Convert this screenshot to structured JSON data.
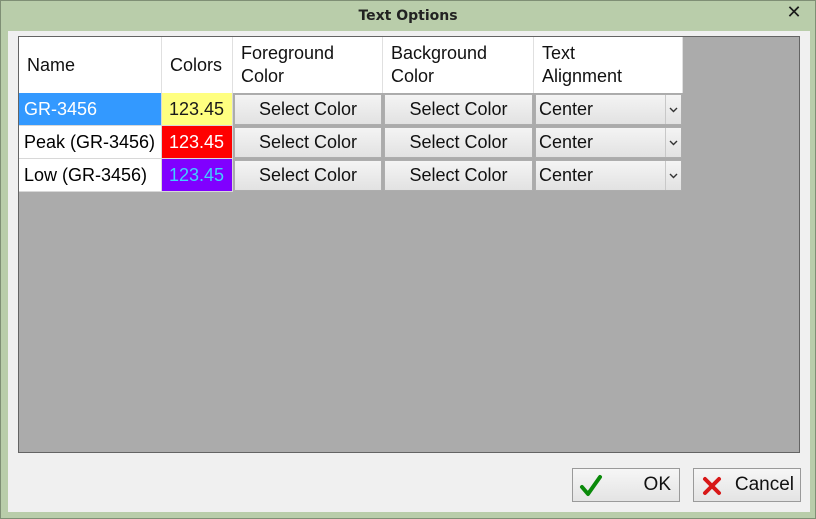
{
  "window": {
    "title": "Text Options",
    "close_glyph": "✕"
  },
  "grid": {
    "columns": [
      {
        "label": "Name"
      },
      {
        "label": "Colors"
      },
      {
        "label": "Foreground\nColor"
      },
      {
        "label": "Background\nColor"
      },
      {
        "label": "Text\nAlignment"
      }
    ],
    "rows": [
      {
        "name": "GR-3456",
        "swatch_text": "123.45",
        "swatch_bg": "#ffff80",
        "swatch_fg": "#1a1a1a",
        "fg_button": "Select Color",
        "bg_button": "Select Color",
        "alignment": "Center",
        "selected": true
      },
      {
        "name": "Peak (GR-3456)",
        "swatch_text": "123.45",
        "swatch_bg": "#ff0000",
        "swatch_fg": "#ffffff",
        "fg_button": "Select Color",
        "bg_button": "Select Color",
        "alignment": "Center",
        "selected": false
      },
      {
        "name": "Low (GR-3456)",
        "swatch_text": "123.45",
        "swatch_bg": "#8000ff",
        "swatch_fg": "#3fd0ff",
        "fg_button": "Select Color",
        "bg_button": "Select Color",
        "alignment": "Center",
        "selected": false
      }
    ]
  },
  "buttons": {
    "ok_label": "OK",
    "cancel_label": "Cancel"
  },
  "colors": {
    "ok_icon": "#0a8a0a",
    "cancel_icon": "#d81818"
  },
  "icons": {
    "ok": "check-icon",
    "cancel": "cross-icon",
    "dropdown": "chevron-down-icon"
  }
}
